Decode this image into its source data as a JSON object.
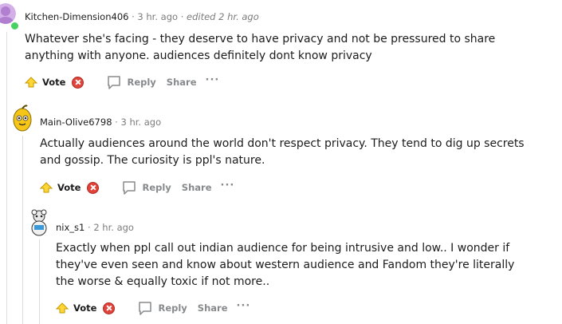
{
  "comments": [
    {
      "username": "Kitchen-Dimension406",
      "separator": "·",
      "time": "3 hr. ago",
      "edited": "edited 2 hr. ago",
      "text": "Whatever she's facing - they deserve to have privacy and not be pressured to share anything with anyone. audiences definitely dont know privacy",
      "vote_label": "Vote",
      "reply_label": "Reply",
      "share_label": "Share",
      "more_label": "···"
    },
    {
      "username": "Main-Olive6798",
      "separator": "·",
      "time": "3 hr. ago",
      "text": "Actually audiences around the world don't respect privacy. They tend to dig up secrets and gossip. The curiosity is ppl's nature.",
      "vote_label": "Vote",
      "reply_label": "Reply",
      "share_label": "Share",
      "more_label": "···"
    },
    {
      "username": "nix_s1",
      "separator": "·",
      "time": "2 hr. ago",
      "text": "Exactly when ppl call out indian audience for being intrusive and low.. I wonder if they've even seen and know about western audience and Fandom they're literally the worse & equally toxic if not more..",
      "vote_label": "Vote",
      "reply_label": "Reply",
      "share_label": "Share",
      "more_label": "···"
    }
  ],
  "icons": {
    "upvote": "upvote-icon",
    "downvote": "downvote-icon",
    "reply": "reply-bubble-icon"
  },
  "colors": {
    "online": "#46d160",
    "downvote": "#e0433a",
    "upvote_fill": "#ffd635",
    "meta_gray": "#7c7c7c",
    "action_gray": "#878a8c"
  }
}
